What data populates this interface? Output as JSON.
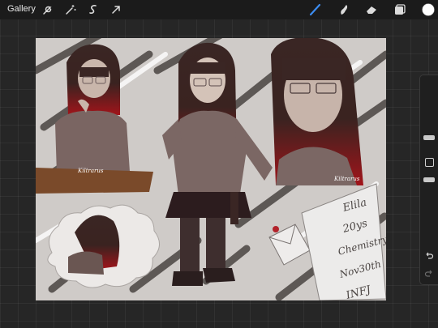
{
  "topbar": {
    "gallery_label": "Gallery",
    "tools_left": [
      "wrench-icon",
      "magic-wand-icon",
      "selection-icon",
      "transform-arrow-icon"
    ],
    "tools_right": [
      "brush-icon",
      "smudge-icon",
      "eraser-icon",
      "layers-icon",
      "color-swatch"
    ],
    "active_color": "#ffffff",
    "brush_active_color": "#3c8cf0"
  },
  "sidebar": {
    "controls": [
      "brush-size-slider",
      "modify-button",
      "opacity-slider",
      "undo-icon",
      "redo-icon"
    ]
  },
  "artwork": {
    "signature_text": "Kiltrarus",
    "note_lines": [
      "Elila",
      "20ys",
      "Chemistry",
      "Nov30th",
      "INFJ"
    ]
  }
}
